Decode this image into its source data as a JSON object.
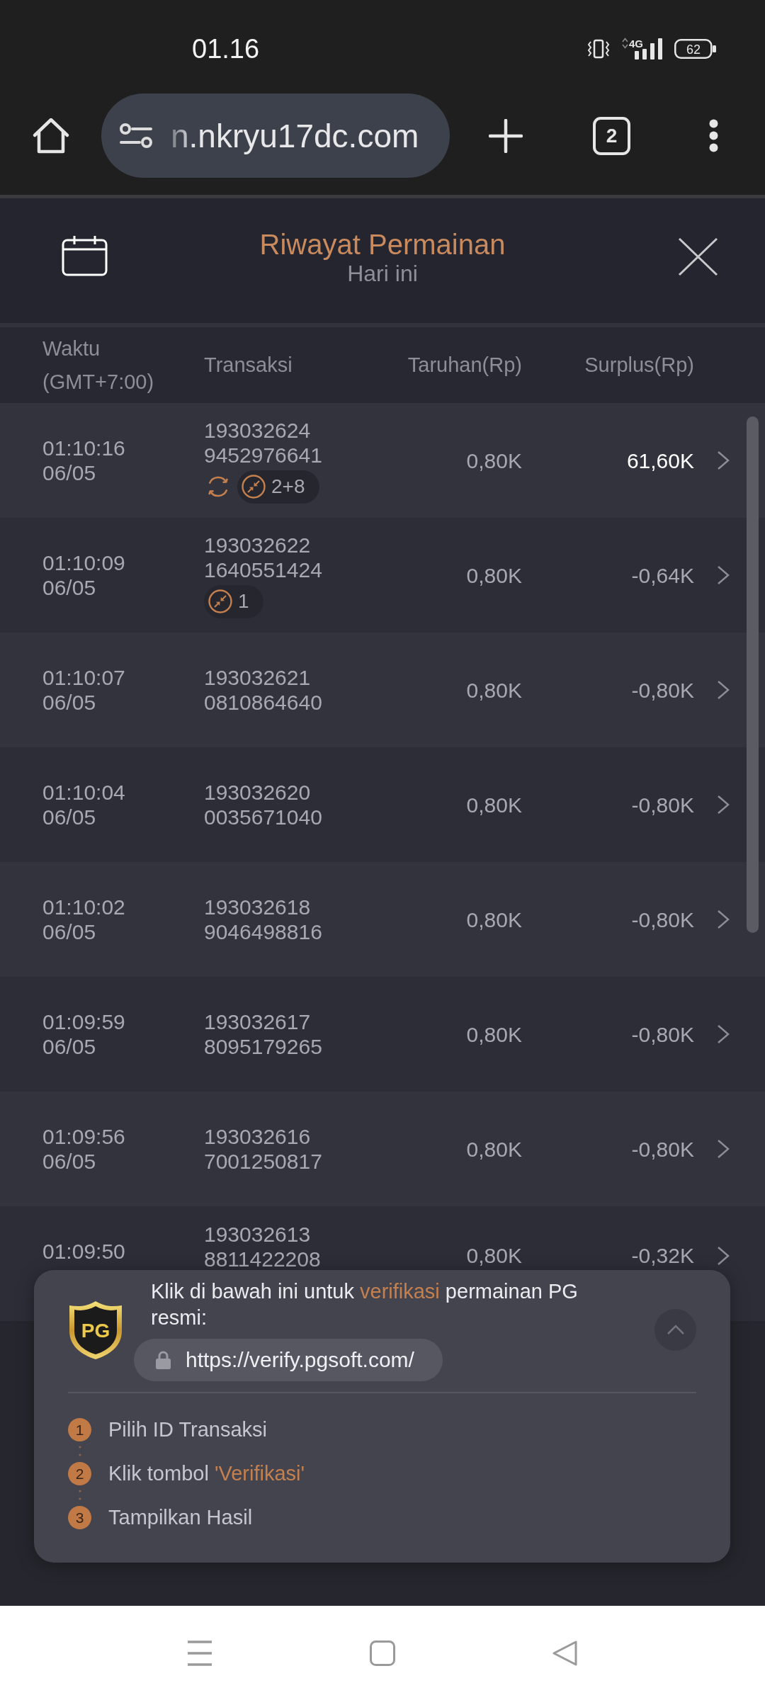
{
  "status_bar": {
    "time": "01.16",
    "network": "4G",
    "battery": "62"
  },
  "browser": {
    "url": "n.nkryu17dc.com",
    "tab_count": "2"
  },
  "header": {
    "title": "Riwayat Permainan",
    "subtitle": "Hari ini"
  },
  "table": {
    "columns": [
      {
        "label": "Waktu (GMT+7:00)"
      },
      {
        "label": "Transaksi"
      },
      {
        "label": "Taruhan(Rp)"
      },
      {
        "label": "Surplus(Rp)"
      }
    ],
    "rows": [
      {
        "time": "01:10:16",
        "date": "06/05",
        "transaction": [
          "193032624",
          "9452976641"
        ],
        "badges": [
          {
            "kind": "cycle"
          },
          {
            "kind": "count",
            "text": "2+8"
          }
        ],
        "bet": "0,80K",
        "surplus": "61,60K",
        "win": true
      },
      {
        "time": "01:10:09",
        "date": "06/05",
        "transaction": [
          "193032622",
          "1640551424"
        ],
        "badges": [
          {
            "kind": "count",
            "text": "1"
          }
        ],
        "bet": "0,80K",
        "surplus": "-0,64K",
        "win": false
      },
      {
        "time": "01:10:07",
        "date": "06/05",
        "transaction": [
          "193032621",
          "0810864640"
        ],
        "bet": "0,80K",
        "surplus": "-0,80K",
        "win": false
      },
      {
        "time": "01:10:04",
        "date": "06/05",
        "transaction": [
          "193032620",
          "0035671040"
        ],
        "bet": "0,80K",
        "surplus": "-0,80K",
        "win": false
      },
      {
        "time": "01:10:02",
        "date": "06/05",
        "transaction": [
          "193032618",
          "9046498816"
        ],
        "bet": "0,80K",
        "surplus": "-0,80K",
        "win": false
      },
      {
        "time": "01:09:59",
        "date": "06/05",
        "transaction": [
          "193032617",
          "8095179265"
        ],
        "bet": "0,80K",
        "surplus": "-0,80K",
        "win": false
      },
      {
        "time": "01:09:56",
        "date": "06/05",
        "transaction": [
          "193032616",
          "7001250817"
        ],
        "bet": "0,80K",
        "surplus": "-0,80K",
        "win": false
      },
      {
        "time": "01:09:50",
        "transaction": [
          "193032613",
          "8811422208"
        ],
        "bet": "0,80K",
        "surplus": "-0,32K",
        "win": false
      }
    ]
  },
  "verify_panel": {
    "logo": "PG",
    "message": [
      {
        "text": "Klik di bawah ini untuk ",
        "highlight": false
      },
      {
        "text": "verifikasi",
        "highlight": true
      },
      {
        "text": " permainan PG resmi:",
        "highlight": false
      }
    ],
    "link": "https://verify.pgsoft.com/",
    "expanded": true,
    "steps": [
      {
        "number": "1",
        "parts": [
          {
            "text": "Pilih ID Transaksi",
            "highlight": false
          }
        ]
      },
      {
        "number": "2",
        "parts": [
          {
            "text": "Klik tombol ",
            "highlight": false
          },
          {
            "text": "'Verifikasi'",
            "highlight": true
          }
        ]
      },
      {
        "number": "3",
        "parts": [
          {
            "text": "Tampilkan Hasil",
            "highlight": false
          }
        ]
      }
    ]
  }
}
